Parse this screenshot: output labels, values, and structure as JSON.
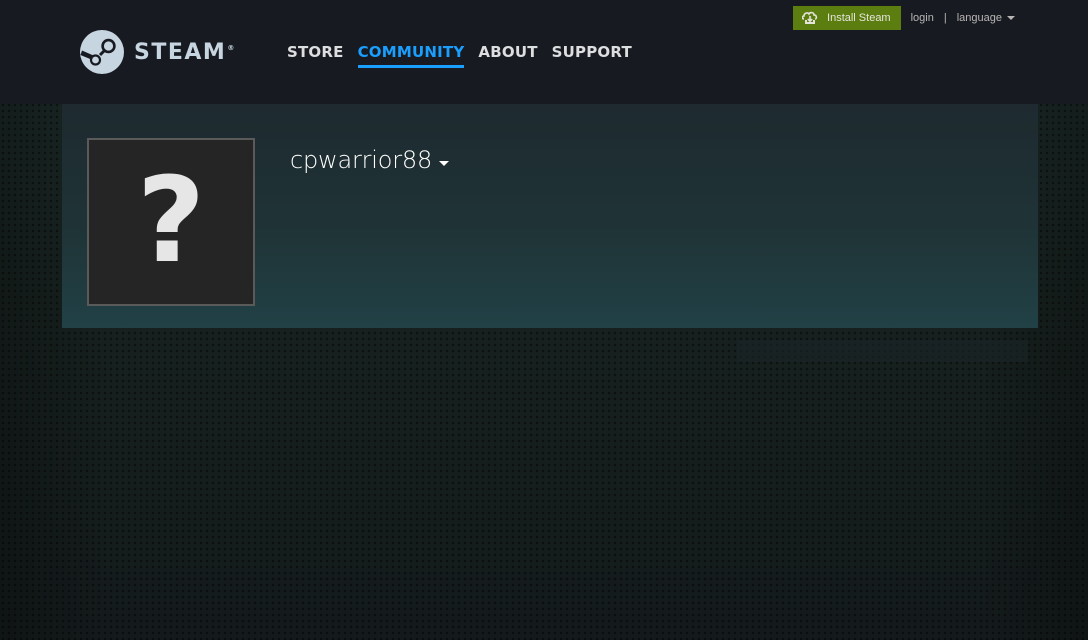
{
  "header": {
    "logo_text": "STEAM",
    "logo_reg": "®",
    "nav": [
      {
        "label": "STORE"
      },
      {
        "label": "COMMUNITY",
        "active": true
      },
      {
        "label": "ABOUT"
      },
      {
        "label": "SUPPORT"
      }
    ],
    "global_actions": {
      "install_label": "Install Steam",
      "login_label": "login",
      "separator": "|",
      "language_label": "language"
    }
  },
  "profile": {
    "persona_name": "cpwarrior88",
    "avatar_placeholder": "?"
  },
  "colors": {
    "header_bg": "#171a21",
    "accent_blue": "#1a9fff",
    "install_green": "#5c7e10",
    "nav_text": "#dcdedf"
  },
  "icons": {
    "logo": "steam-logo-icon",
    "install": "download-cloud-icon",
    "dropdown": "caret-down-icon"
  }
}
